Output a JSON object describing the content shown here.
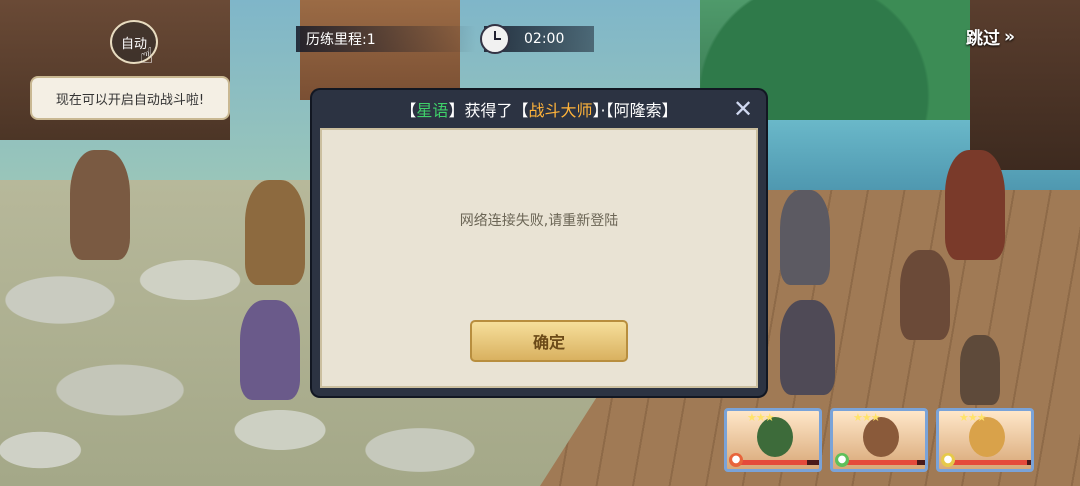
{
  "hud": {
    "auto_label": "自动",
    "tip_text": "现在可以开启自动战斗啦!",
    "mileage_label": "历练里程:1",
    "timer": "02:00",
    "skip_label": "跳过",
    "skip_arrow": "»"
  },
  "dialog": {
    "header": {
      "open1": "【",
      "name": "星语",
      "mid": "】获得了【",
      "title": "战斗大师",
      "close2": "】·【",
      "other": "阿隆索",
      "end": "】"
    },
    "close_icon": "close-icon",
    "message": "网络连接失败,请重新登陆",
    "ok_label": "确定"
  },
  "portraits": [
    {
      "icon": "fire-element-icon",
      "color": "#e8643a",
      "hp": 0.85,
      "stars": "★★★"
    },
    {
      "icon": "wind-element-icon",
      "color": "#5fbf5a",
      "hp": 0.9,
      "stars": "★★★"
    },
    {
      "icon": "light-element-icon",
      "color": "#e6c94a",
      "hp": 0.95,
      "stars": "★★★"
    }
  ]
}
